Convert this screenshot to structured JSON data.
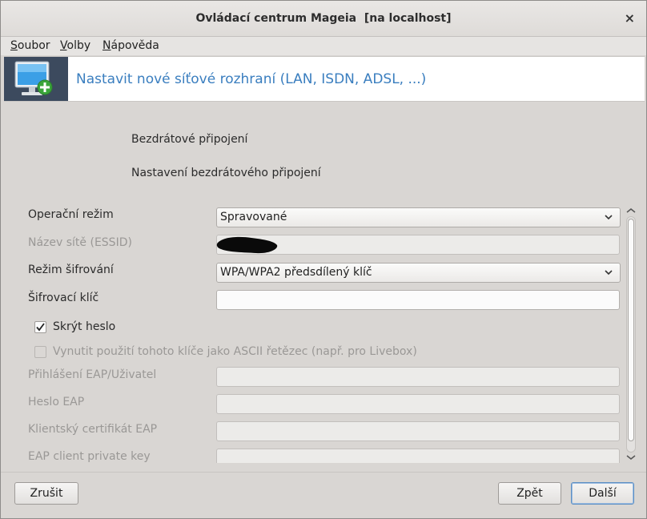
{
  "window": {
    "title": "Ovládací centrum Mageia  [na localhost]",
    "close_label": "×"
  },
  "menu": {
    "items": [
      {
        "label": "Soubor",
        "mnemonic": "S",
        "rest": "oubor"
      },
      {
        "label": "Volby",
        "mnemonic": "V",
        "rest": "olby"
      },
      {
        "label": "Nápověda",
        "mnemonic": "N",
        "rest": "ápověda"
      }
    ]
  },
  "banner": {
    "title": "Nastavit nové síťové rozhraní (LAN, ISDN, ADSL, ...)",
    "icon": "computer-add-icon"
  },
  "intro": {
    "line1": "Bezdrátové připojení",
    "line2": "Nastavení bezdrátového připojení"
  },
  "form": {
    "mode": {
      "label": "Operační režim",
      "value": "Spravované"
    },
    "essid": {
      "label": "Název sítě (ESSID)",
      "value": ""
    },
    "encryption": {
      "label": "Režim šifrování",
      "value": "WPA/WPA2 předsdílený klíč"
    },
    "key": {
      "label": "Šifrovací klíč",
      "value": ""
    },
    "hide_password": {
      "label": "Skrýt heslo",
      "checked": true
    },
    "force_ascii": {
      "label": "Vynutit použití tohoto klíče jako ASCII řetězec (např. pro Livebox)",
      "checked": false
    },
    "eap_login": {
      "label": "Přihlášení EAP/Uživatel",
      "value": ""
    },
    "eap_password": {
      "label": "Heslo EAP",
      "value": ""
    },
    "eap_client_cert": {
      "label": "Klientský certifikát EAP",
      "value": ""
    },
    "eap_private_key": {
      "label": "EAP client private key",
      "value": ""
    }
  },
  "buttons": {
    "cancel": "Zrušit",
    "back": "Zpět",
    "next": "Další"
  },
  "colors": {
    "accent": "#3a7ebf",
    "banner_icon_bg": "#3c4a5e"
  }
}
